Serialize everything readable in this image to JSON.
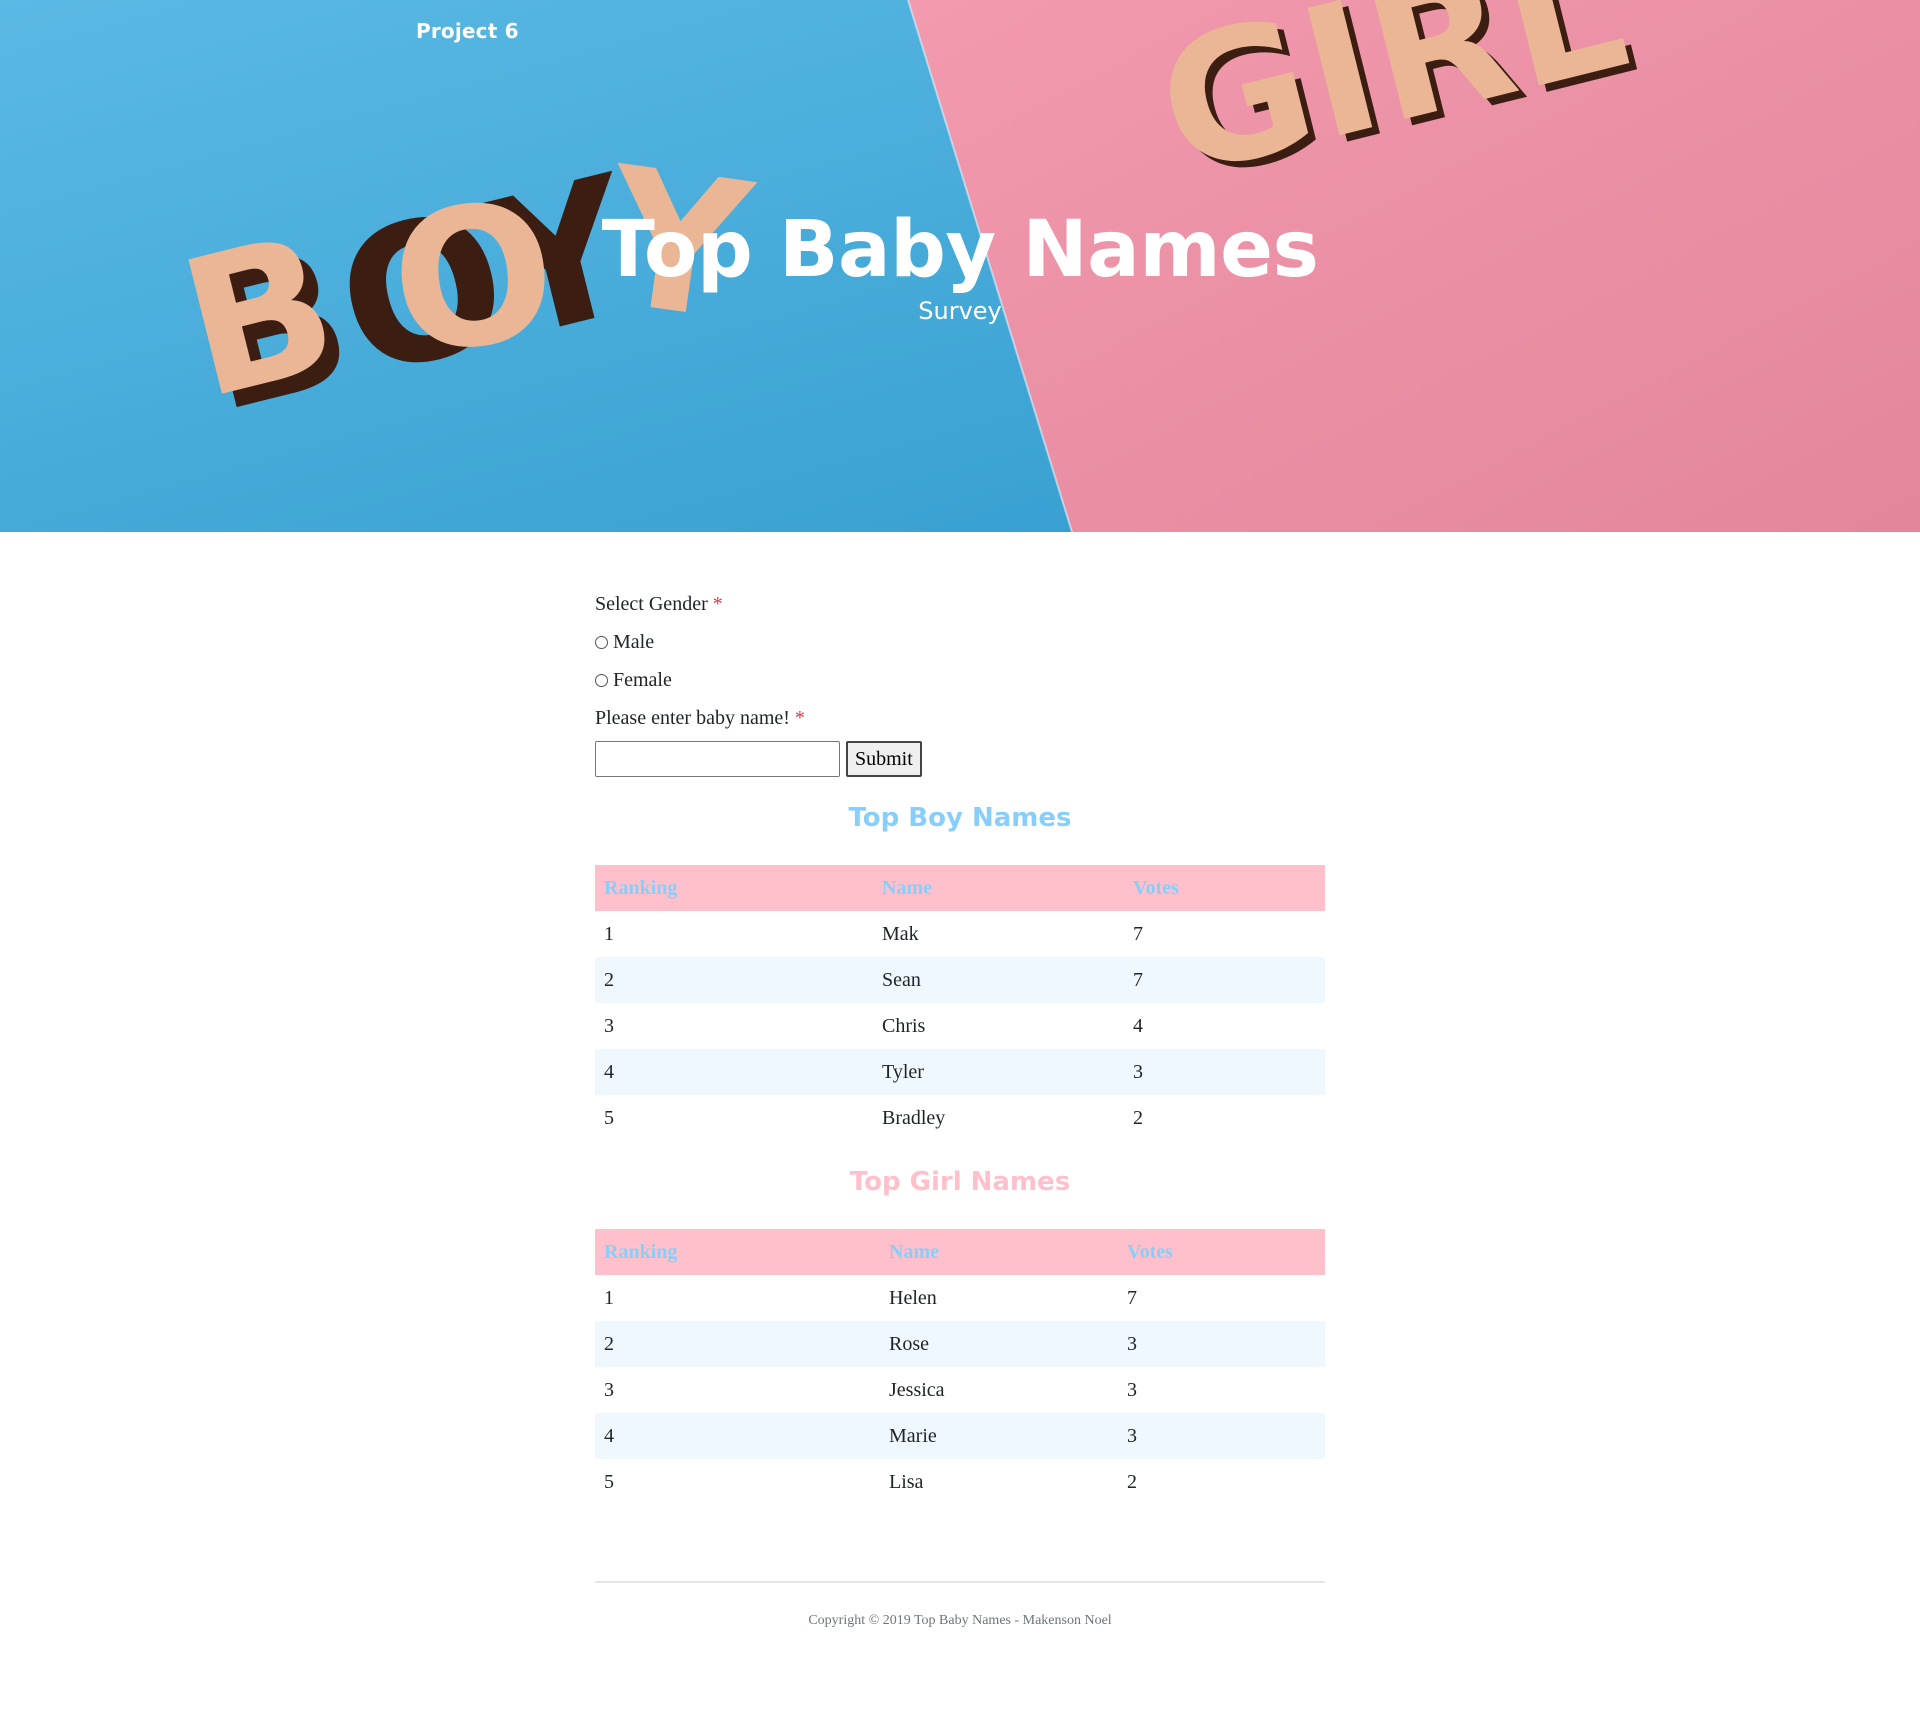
{
  "header": {
    "brand": "Project 6",
    "title": "Top Baby Names",
    "subtitle": "Survey",
    "image_letters": {
      "boy": "BOY",
      "girl": "GIRL"
    }
  },
  "colors": {
    "boy_blue": "#3aa5d8",
    "girl_pink": "#e88a9e",
    "accent_blue": "#87cefa",
    "accent_pink": "#ffc0cb",
    "required": "#dc3545"
  },
  "form": {
    "gender_label": "Select Gender",
    "required_mark": "*",
    "options": [
      {
        "label": "Male",
        "selected": false
      },
      {
        "label": "Female",
        "selected": false
      }
    ],
    "name_label": "Please enter baby name!",
    "name_value": "",
    "submit_label": "Submit"
  },
  "boys": {
    "title": "Top Boy Names",
    "columns": [
      "Ranking",
      "Name",
      "Votes"
    ],
    "rows": [
      [
        "1",
        "Mak",
        "7"
      ],
      [
        "2",
        "Sean",
        "7"
      ],
      [
        "3",
        "Chris",
        "4"
      ],
      [
        "4",
        "Tyler",
        "3"
      ],
      [
        "5",
        "Bradley",
        "2"
      ]
    ]
  },
  "girls": {
    "title": "Top Girl Names",
    "columns": [
      "Ranking",
      "Name",
      "Votes"
    ],
    "rows": [
      [
        "1",
        "Helen",
        "7"
      ],
      [
        "2",
        "Rose",
        "3"
      ],
      [
        "3",
        "Jessica",
        "3"
      ],
      [
        "4",
        "Marie",
        "3"
      ],
      [
        "5",
        "Lisa",
        "2"
      ]
    ]
  },
  "footer": {
    "copyright": "Copyright © 2019 Top Baby Names - Makenson Noel"
  }
}
